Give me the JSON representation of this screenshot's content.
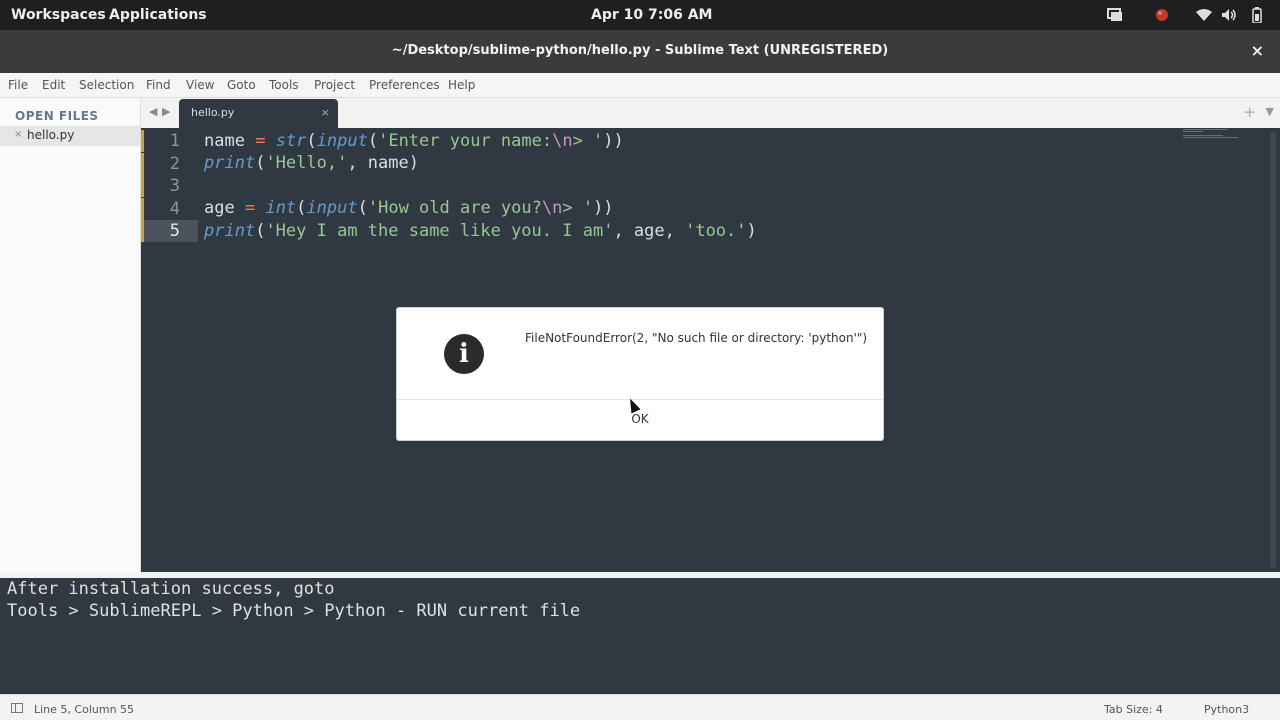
{
  "topbar": {
    "workspaces": "Workspaces",
    "applications": "Applications",
    "clock": "Apr 10  7:06 AM"
  },
  "window": {
    "title": "~/Desktop/sublime-python/hello.py - Sublime Text (UNREGISTERED)",
    "close_glyph": "×"
  },
  "menu": {
    "file": "File",
    "edit": "Edit",
    "selection": "Selection",
    "find": "Find",
    "view": "View",
    "goto": "Goto",
    "tools": "Tools",
    "project": "Project",
    "preferences": "Preferences",
    "help": "Help"
  },
  "sidebar": {
    "header": "OPEN FILES",
    "file_close": "×",
    "file_name": "hello.py"
  },
  "tabs": {
    "active_label": "hello.py",
    "close_glyph": "×",
    "new_tab": "+"
  },
  "editor": {
    "line_numbers": [
      "1",
      "2",
      "3",
      "4",
      "5"
    ],
    "lines": {
      "l1": {
        "a": "name ",
        "b": "=",
        "c": " ",
        "d": "str",
        "e": "(",
        "f": "input",
        "g": "(",
        "h": "'Enter your name:",
        "i": "\\n",
        "j": "> '",
        "k": "))"
      },
      "l2": {
        "a": "print",
        "b": "(",
        "c": "'Hello,'",
        "d": ", name)"
      },
      "l4": {
        "a": "age ",
        "b": "=",
        "c": " ",
        "d": "int",
        "e": "(",
        "f": "input",
        "g": "(",
        "h": "'How old are you?",
        "i": "\\n",
        "j": "> '",
        "k": "))"
      },
      "l5": {
        "a": "print",
        "b": "(",
        "c": "'Hey I am the same like you. I am'",
        "d": ", age, ",
        "e": "'too.'",
        "f": ")"
      }
    },
    "current_line": 5
  },
  "dialog": {
    "icon_glyph": "i",
    "message": "FileNotFoundError(2, \"No such file or directory: 'python'\")",
    "ok_label": "OK"
  },
  "output_panel": {
    "line1": "After installation success, goto",
    "line2": "Tools > SublimeREPL > Python > Python - RUN current file"
  },
  "statusbar": {
    "position": "Line 5, Column 55",
    "tab_size": "Tab Size: 4",
    "syntax": "Python3"
  },
  "colors": {
    "editor_bg": "#303841",
    "keyword": "#6699cc",
    "string": "#99c794",
    "operator": "#f97b58",
    "escape": "#c695c6",
    "modified_marker": "#d4a03b"
  }
}
